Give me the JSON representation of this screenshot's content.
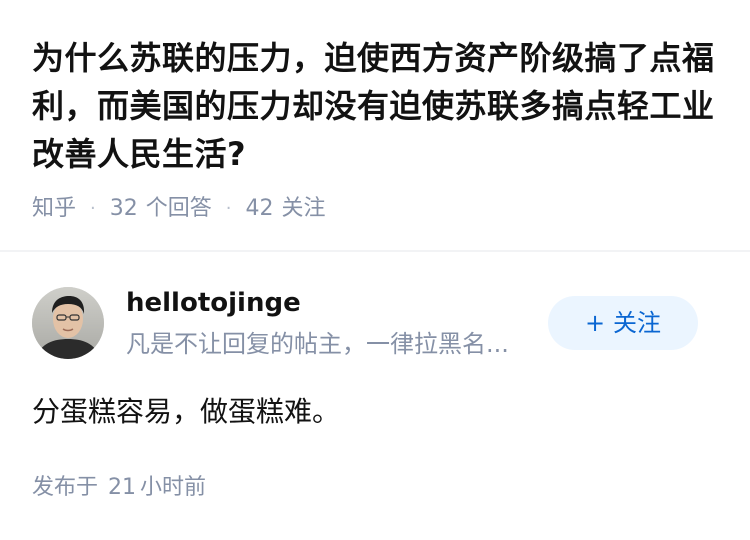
{
  "question": {
    "title": "为什么苏联的压力，迫使西方资产阶级搞了点福利，而美国的压力却没有迫使苏联多搞点轻工业改善人民生活?",
    "source": "知乎",
    "separator": "·",
    "answers_count": "32",
    "answers_label": "个回答",
    "followers_count": "42",
    "followers_label": "关注"
  },
  "answer": {
    "author": {
      "name": "hellotojinge",
      "bio": "凡是不让回复的帖主，一律拉黑名...",
      "follow_plus": "+",
      "follow_label": "关注"
    },
    "content": "分蛋糕容易，做蛋糕难。",
    "published_prefix": "发布于",
    "published_number": "21",
    "published_unit": "小时前"
  },
  "colors": {
    "title": "#121212",
    "meta": "#8590a6",
    "follow_bg": "#ebf5ff",
    "follow_text": "#0a66d2"
  }
}
